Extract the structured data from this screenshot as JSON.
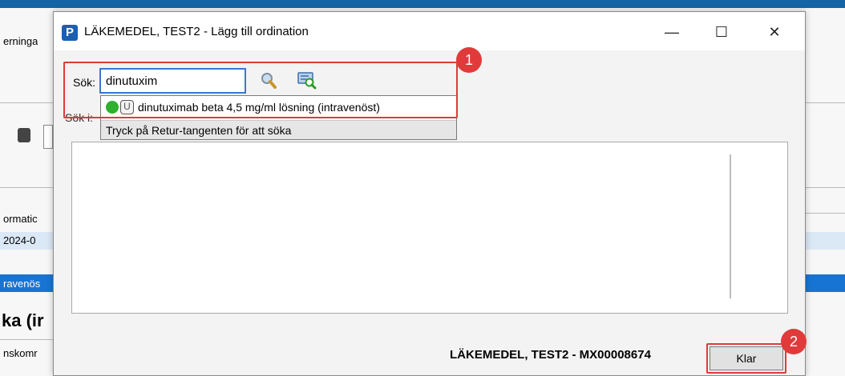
{
  "background_app": {
    "left_texts": [
      "erninga",
      "ormatic",
      "2024-0",
      "ravenös",
      "ka (ir",
      "nskomr"
    ],
    "sok_i_label": "Sök i:"
  },
  "dialog": {
    "app_icon_letter": "P",
    "title": "LÄKEMEDEL, TEST2 - Lägg till ordination",
    "minimize": "—",
    "maximize": "☐",
    "close": "✕",
    "search": {
      "label": "Sök:",
      "value": "dinutuxim"
    },
    "suggestion": {
      "item": "dinutuximab beta 4,5 mg/ml lösning (intravenöst)",
      "hint": "Tryck på Retur-tangenten för att söka"
    },
    "footer_patient": "LÄKEMEDEL, TEST2 - MX00008674",
    "done_button": "Klar"
  },
  "annotations": {
    "badge_1": "1",
    "badge_2": "2"
  },
  "colors": {
    "annotation_red": "#e03a3a",
    "accent_blue": "#1a5fb4",
    "status_green": "#2fb12f"
  }
}
